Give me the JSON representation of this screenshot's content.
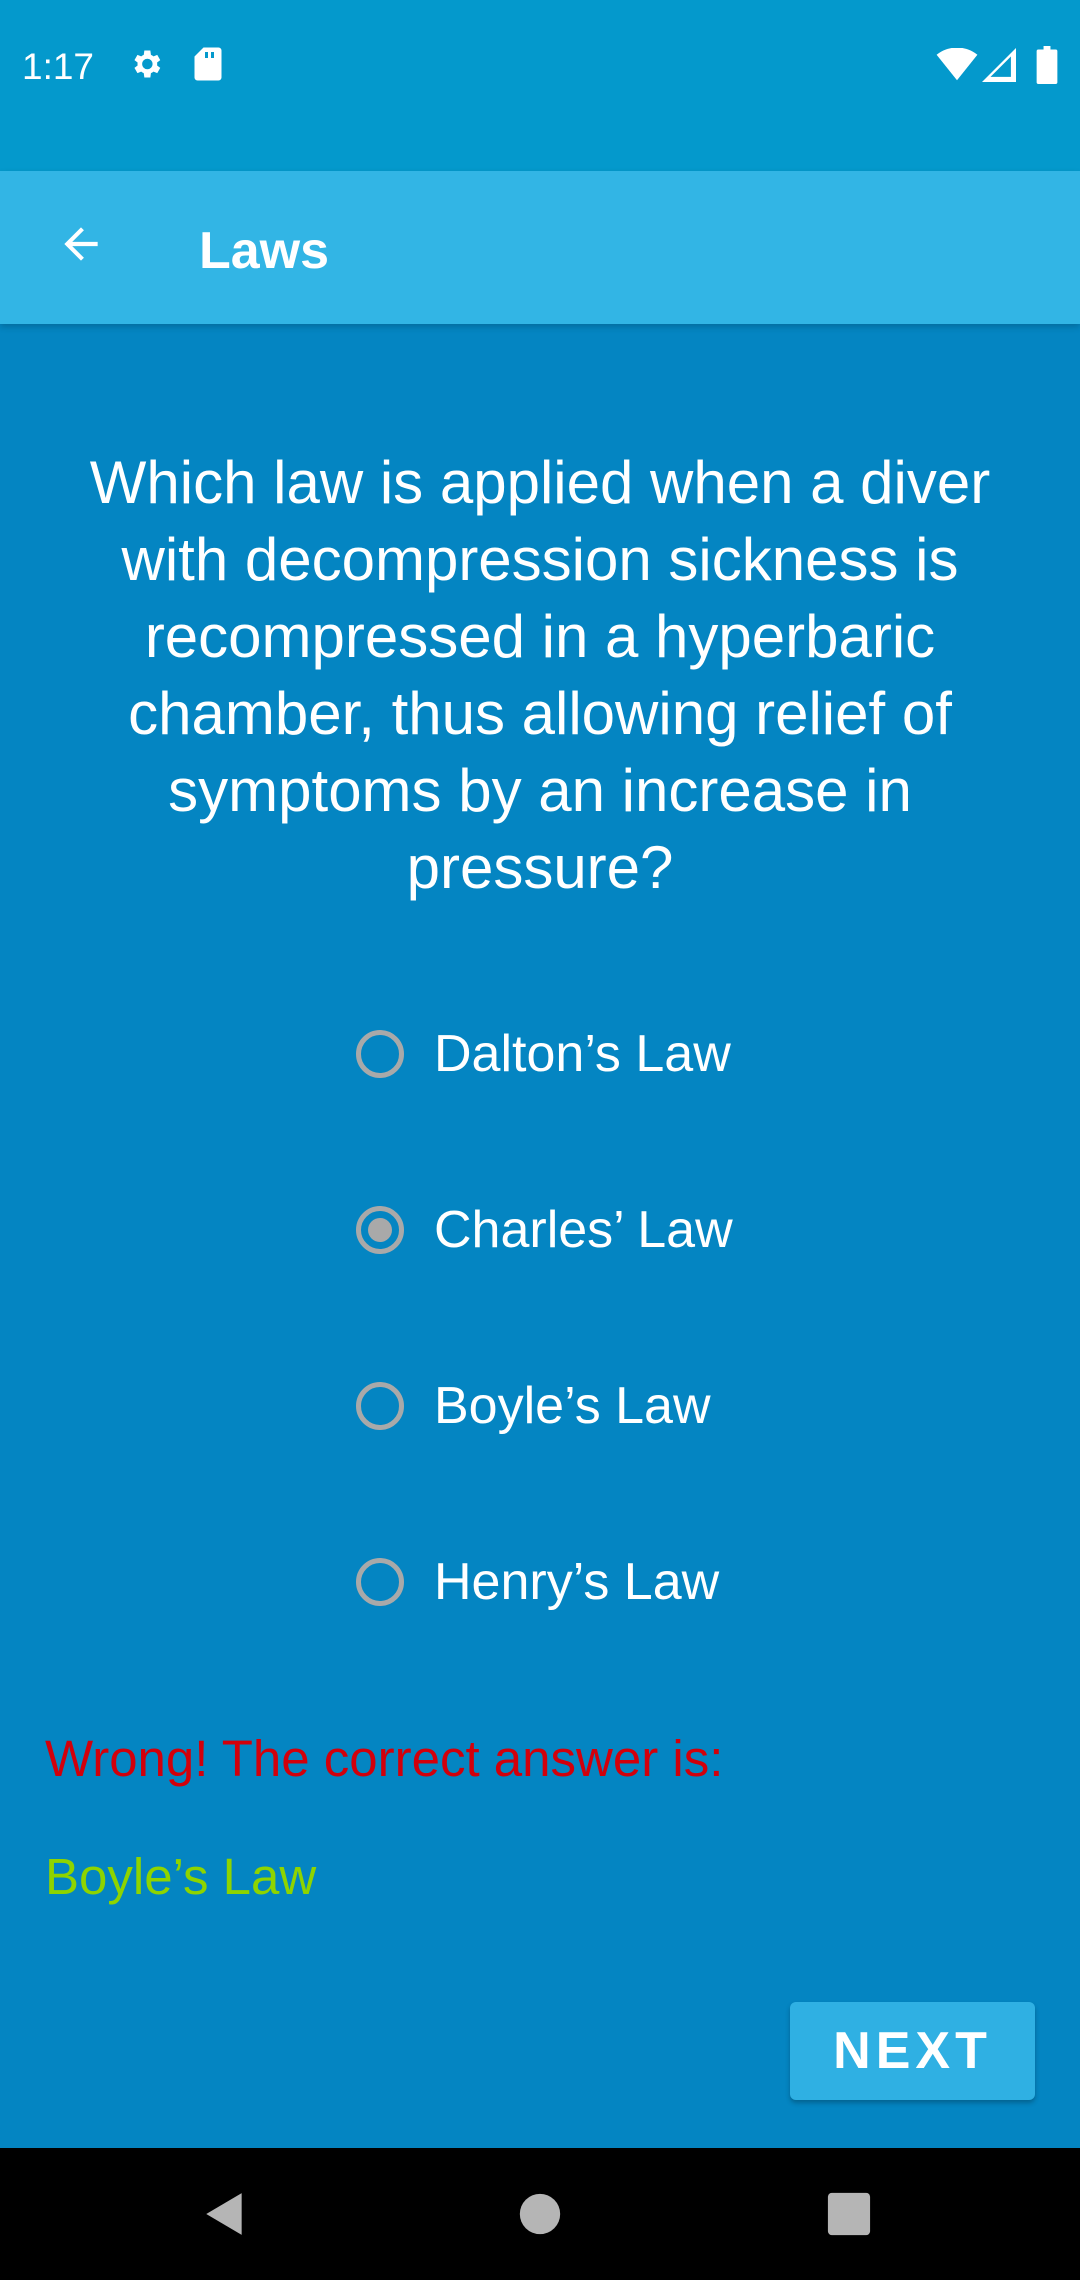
{
  "status_bar": {
    "time": "1:17",
    "icons": [
      "gear-icon",
      "sd-card-icon",
      "wifi-icon",
      "signal-icon",
      "battery-icon"
    ]
  },
  "app_bar": {
    "title": "Laws",
    "back_icon": "arrow-left-icon"
  },
  "quiz": {
    "question": "Which law is applied when a diver with decompression sickness is recompressed in a hyperbaric chamber, thus allowing relief of symptoms by an increase in pressure?",
    "options": [
      {
        "label": "Dalton’s Law",
        "selected": false
      },
      {
        "label": "Charles’ Law",
        "selected": true
      },
      {
        "label": "Boyle’s Law",
        "selected": false
      },
      {
        "label": "Henry’s Law",
        "selected": false
      }
    ],
    "feedback": {
      "wrong_text": "Wrong! The correct answer is:",
      "correct_answer": "Boyle’s Law"
    },
    "next_label": "NEXT"
  },
  "colors": {
    "background": "#0485c2",
    "status_bar": "#0499cc",
    "app_bar": "#32b5e5",
    "wrong": "#d2000b",
    "correct": "#8ed400",
    "radio": "#a9a9a9"
  },
  "nav_bar": {
    "icons": [
      "back-triangle-icon",
      "home-circle-icon",
      "recents-square-icon"
    ]
  }
}
